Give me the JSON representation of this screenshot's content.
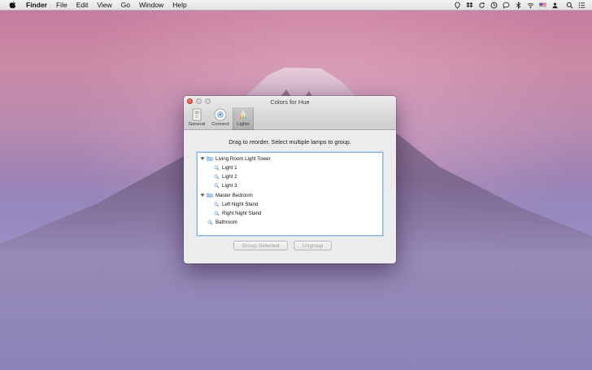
{
  "menubar": {
    "app_name": "Finder",
    "items": [
      "File",
      "Edit",
      "View",
      "Go",
      "Window",
      "Help"
    ],
    "tray_icons": [
      "location-icon",
      "dropbox-icon",
      "sync-icon",
      "time-machine-icon",
      "chat-icon",
      "bluetooth-icon",
      "wifi-icon",
      "flag-icon",
      "user-icon",
      "spotlight-icon",
      "notification-list-icon"
    ]
  },
  "window": {
    "title": "Colors for Hue",
    "toolbar": [
      {
        "label": "General",
        "icon": "general-icon",
        "selected": false
      },
      {
        "label": "Connect",
        "icon": "connect-icon",
        "selected": false
      },
      {
        "label": "Lights",
        "icon": "lights-icon",
        "selected": true
      }
    ],
    "instruction": "Drag to reorder. Select multiple lamps to group.",
    "tree": [
      {
        "type": "group",
        "label": "Living Room Light Tower",
        "expanded": true,
        "children": [
          "Light 1",
          "Light 2",
          "Light 3"
        ]
      },
      {
        "type": "group",
        "label": "Master Bedroom",
        "expanded": true,
        "children": [
          "Left Night Stand",
          "Right Night Stand"
        ]
      },
      {
        "type": "lamp",
        "label": "Bathroom"
      }
    ],
    "buttons": {
      "group_selected": "Group Selected",
      "ungroup": "Ungroup"
    }
  },
  "colors": {
    "close": "#e0443a",
    "selection_border": "#8fb3d9",
    "disabled_text": "#9a9a9a"
  }
}
